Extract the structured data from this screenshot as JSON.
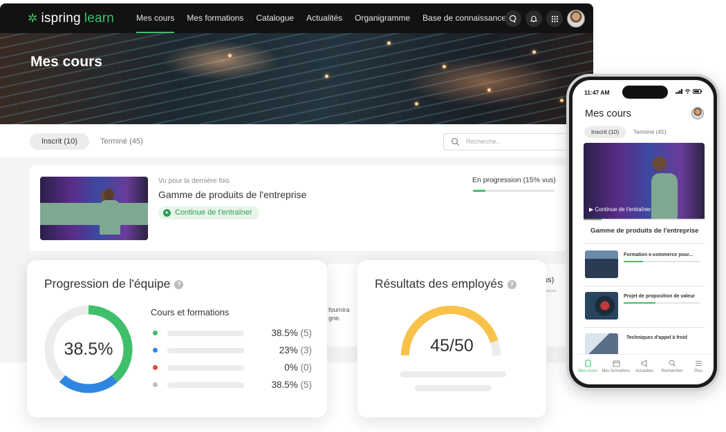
{
  "app": {
    "logo_main": "ispring",
    "logo_accent": "learn",
    "brand_color": "#3fbf6a"
  },
  "nav": {
    "items": [
      {
        "label": "Mes cours"
      },
      {
        "label": "Mes formations"
      },
      {
        "label": "Catalogue"
      },
      {
        "label": "Actualités"
      },
      {
        "label": "Organigramme"
      },
      {
        "label": "Base de connaissances"
      }
    ],
    "icons": [
      "chat-icon",
      "bell-icon",
      "apps-grid-icon",
      "user-avatar"
    ]
  },
  "page": {
    "title": "Mes cours",
    "tabs": [
      {
        "label": "Inscrit (10)"
      },
      {
        "label": "Terminé (45)"
      }
    ],
    "search_placeholder": "Recherche..."
  },
  "course_card": {
    "meta": "Vu pour la dernière fois",
    "title": "Gamme de produits de l'entreprise",
    "action": "Continue de t'entraîner",
    "progress_label": "En progression (15% vus)",
    "progress": 0.15
  },
  "behind_card": {
    "line1": "fournira",
    "line2": "gne.",
    "line3": "us)"
  },
  "team_card": {
    "title": "Progression de l'équipe",
    "donut_value": "38.5%",
    "donut_fraction": 0.385,
    "legend_title": "Cours et formations",
    "rows": [
      {
        "color": "#3fbf6a",
        "value": "38.5%",
        "count": "(5)"
      },
      {
        "color": "#2f86e0",
        "value": "23%",
        "count": "(3)"
      },
      {
        "color": "#e8463c",
        "value": "0%",
        "count": "(0)"
      },
      {
        "color": "#bdbdbd",
        "value": "38.5%",
        "count": "(5)"
      }
    ]
  },
  "employees_card": {
    "title": "Résultats des employés",
    "score": "45/50",
    "score_fraction": 0.9,
    "gauge_color": "#f9c24a"
  },
  "phone": {
    "time": "11:47 AM",
    "title": "Mes cours",
    "tab_on": "Inscrit (10)",
    "tab_off": "Terminé (45)",
    "hero_label": "Continue de t'entraîner",
    "hero_progress": 0.15,
    "hero_title": "Gamme de produits de l'entreprise",
    "items": [
      {
        "title": "Formation e-commerce pour...",
        "progress": 0.25
      },
      {
        "title": "Projet de proposition de valeur",
        "progress": 0.42
      },
      {
        "title": "Techniques d'appel à froid",
        "progress": 0
      }
    ],
    "bottom_nav": [
      {
        "label": "Mes cours"
      },
      {
        "label": "Mes formations"
      },
      {
        "label": "Actualités"
      },
      {
        "label": "Rechercher"
      },
      {
        "label": "Plus"
      }
    ]
  }
}
